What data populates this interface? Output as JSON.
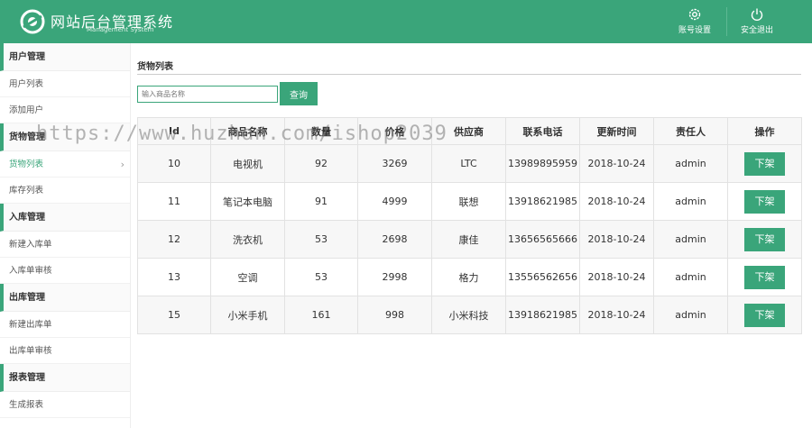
{
  "header": {
    "title": "网站后台管理系统",
    "subtitle": "Management System",
    "buttons": [
      {
        "label": "账号设置",
        "icon": "gear-icon"
      },
      {
        "label": "安全退出",
        "icon": "power-icon"
      }
    ]
  },
  "sidebar": {
    "sections": [
      {
        "title": "用户管理",
        "items": [
          "用户列表",
          "添加用户"
        ]
      },
      {
        "title": "货物管理",
        "items": [
          "货物列表",
          "库存列表"
        ]
      },
      {
        "title": "入库管理",
        "items": [
          "新建入库单",
          "入库单审核"
        ]
      },
      {
        "title": "出库管理",
        "items": [
          "新建出库单",
          "出库单审核"
        ]
      },
      {
        "title": "报表管理",
        "items": [
          "生成报表"
        ]
      }
    ],
    "active_item": "货物列表",
    "chevron": "›"
  },
  "main": {
    "page_title": "货物列表",
    "search": {
      "placeholder": "输入商品名称",
      "button_label": "查询"
    },
    "table": {
      "headers": [
        "Id",
        "商品名称",
        "数量",
        "价格",
        "供应商",
        "联系电话",
        "更新时间",
        "责任人",
        "操作"
      ],
      "rows": [
        [
          "10",
          "电视机",
          "92",
          "3269",
          "LTC",
          "13989895959",
          "2018-10-24",
          "admin"
        ],
        [
          "11",
          "笔记本电脑",
          "91",
          "4999",
          "联想",
          "13918621985",
          "2018-10-24",
          "admin"
        ],
        [
          "12",
          "洗衣机",
          "53",
          "2698",
          "康佳",
          "13656565666",
          "2018-10-24",
          "admin"
        ],
        [
          "13",
          "空调",
          "53",
          "2998",
          "格力",
          "13556562656",
          "2018-10-24",
          "admin"
        ],
        [
          "15",
          "小米手机",
          "161",
          "998",
          "小米科技",
          "13918621985",
          "2018-10-24",
          "admin"
        ]
      ],
      "action_label": "下架"
    }
  },
  "watermark": "https://www.huzhan.com/ishop2039",
  "colors": {
    "accent": "#3aa57a",
    "header_bg": "#3aa57a"
  }
}
